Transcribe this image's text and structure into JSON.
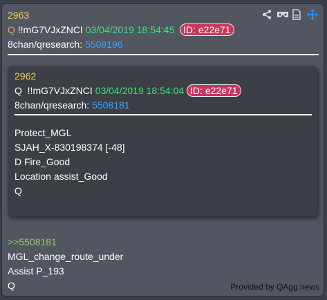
{
  "post": {
    "number": "2963",
    "tripcode_prefix": "Q",
    "tripcode": "!!mG7VJxZNCI",
    "date": "03/04/2019 18:54:45",
    "id": "ID: e22e71",
    "source_label": "8chan/qresearch:",
    "source_number": "5508196",
    "reply_ref": ">>5508181",
    "body_lines": [
      "MGL_change_route_under",
      "Assist P_193",
      "Q"
    ],
    "footer": "Provided by QAgg.news"
  },
  "quoted": {
    "number": "2962",
    "tripcode_prefix": "Q",
    "tripcode": "!!mG7VJxZNCI",
    "date": "03/04/2019 18:54:04",
    "id": "ID: e22e71",
    "source_label": "8chan/qresearch:",
    "source_number": "5508181",
    "body_lines": [
      "Protect_MGL",
      "SJAH_X-830198374 [-48]",
      "D Fire_Good",
      "Location assist_Good",
      "Q"
    ]
  },
  "colors": {
    "background": "#3b3f48",
    "post_bg": "#515661",
    "quote_bg": "#3c3f46",
    "number": "#f2d24a",
    "date": "#3ee37e",
    "link": "#3ca2ff",
    "id_badge": "#c8365e",
    "reply_ref": "#8fcf5e"
  },
  "toolbar": {
    "icons": [
      "share-icon",
      "vr-icon",
      "document-icon",
      "move-icon"
    ]
  }
}
